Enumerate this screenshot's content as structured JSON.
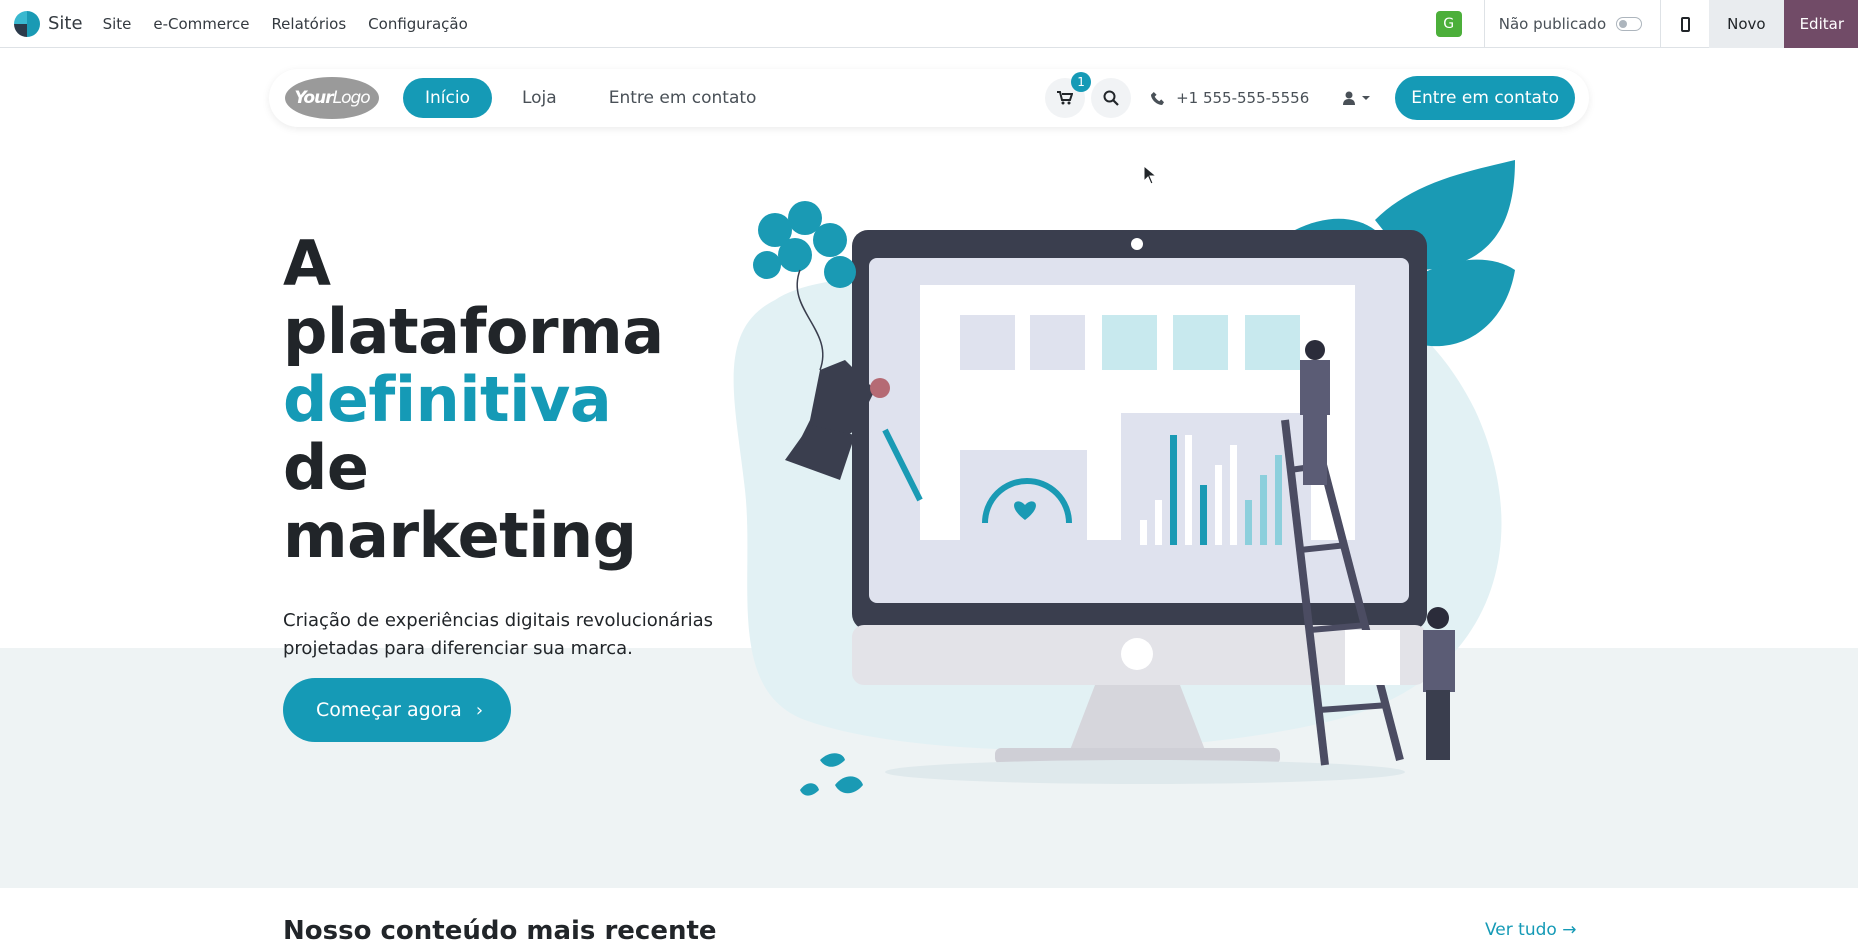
{
  "admin": {
    "brand": "Site",
    "menu": [
      "Site",
      "e-Commerce",
      "Relatórios",
      "Configuração"
    ],
    "user_initial": "G",
    "publish_status": "Não publicado",
    "new_label": "Novo",
    "edit_label": "Editar"
  },
  "navbar": {
    "logo_text_bold": "Your",
    "logo_text_light": "Logo",
    "links": [
      "Início",
      "Loja",
      "Entre em contato"
    ],
    "active_index": 0,
    "cart_count": "1",
    "phone": "+1 555-555-5556",
    "cta": "Entre em contato"
  },
  "hero": {
    "title_line1": "A",
    "title_line2": "plataforma",
    "title_accent": "definitiva",
    "title_line4": "de",
    "title_line5": "marketing",
    "subtitle": "Criação de experiências digitais revolucionárias projetadas para diferenciar sua marca.",
    "button_label": "Começar agora",
    "button_chevron": "›"
  },
  "latest": {
    "heading": "Nosso conteúdo mais recente",
    "see_all": "Ver tudo →"
  },
  "colors": {
    "accent": "#159ab6",
    "edit_button": "#714b67",
    "user_badge": "#4caf3a"
  }
}
